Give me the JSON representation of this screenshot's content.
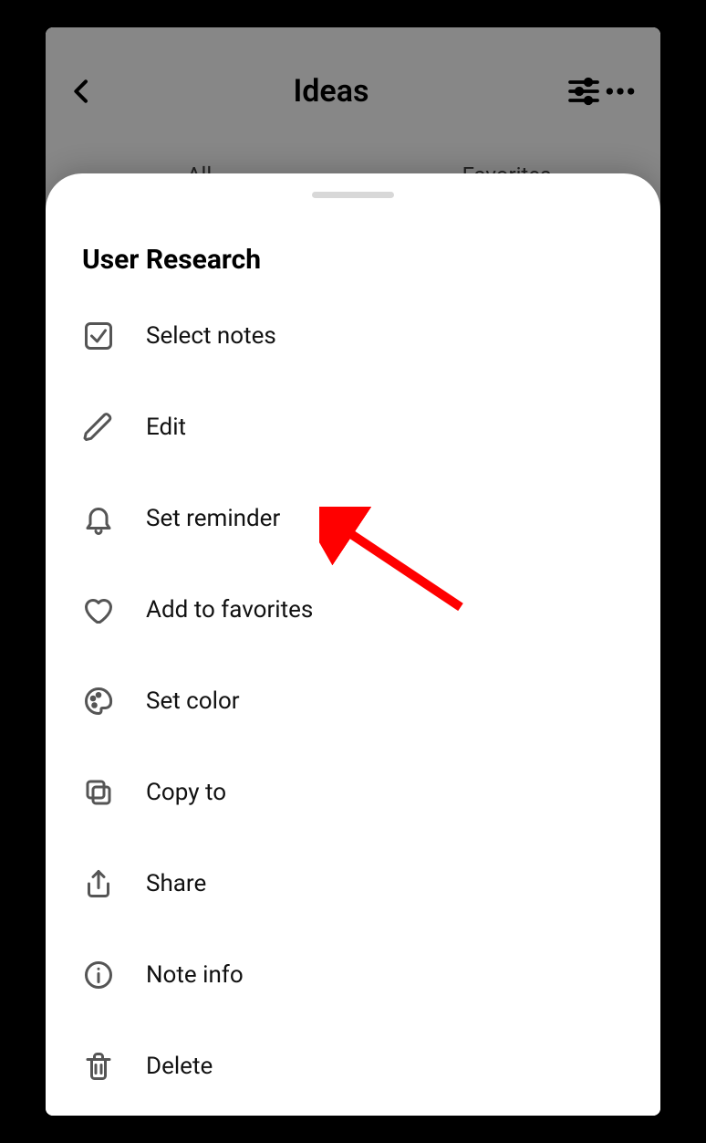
{
  "background": {
    "title": "Ideas",
    "tabs": [
      "All",
      "Favorites"
    ]
  },
  "sheet": {
    "title": "User Research",
    "items": [
      {
        "label": "Select notes"
      },
      {
        "label": "Edit"
      },
      {
        "label": "Set reminder"
      },
      {
        "label": "Add to favorites"
      },
      {
        "label": "Set color"
      },
      {
        "label": "Copy to"
      },
      {
        "label": "Share"
      },
      {
        "label": "Note info"
      },
      {
        "label": "Delete"
      }
    ]
  }
}
